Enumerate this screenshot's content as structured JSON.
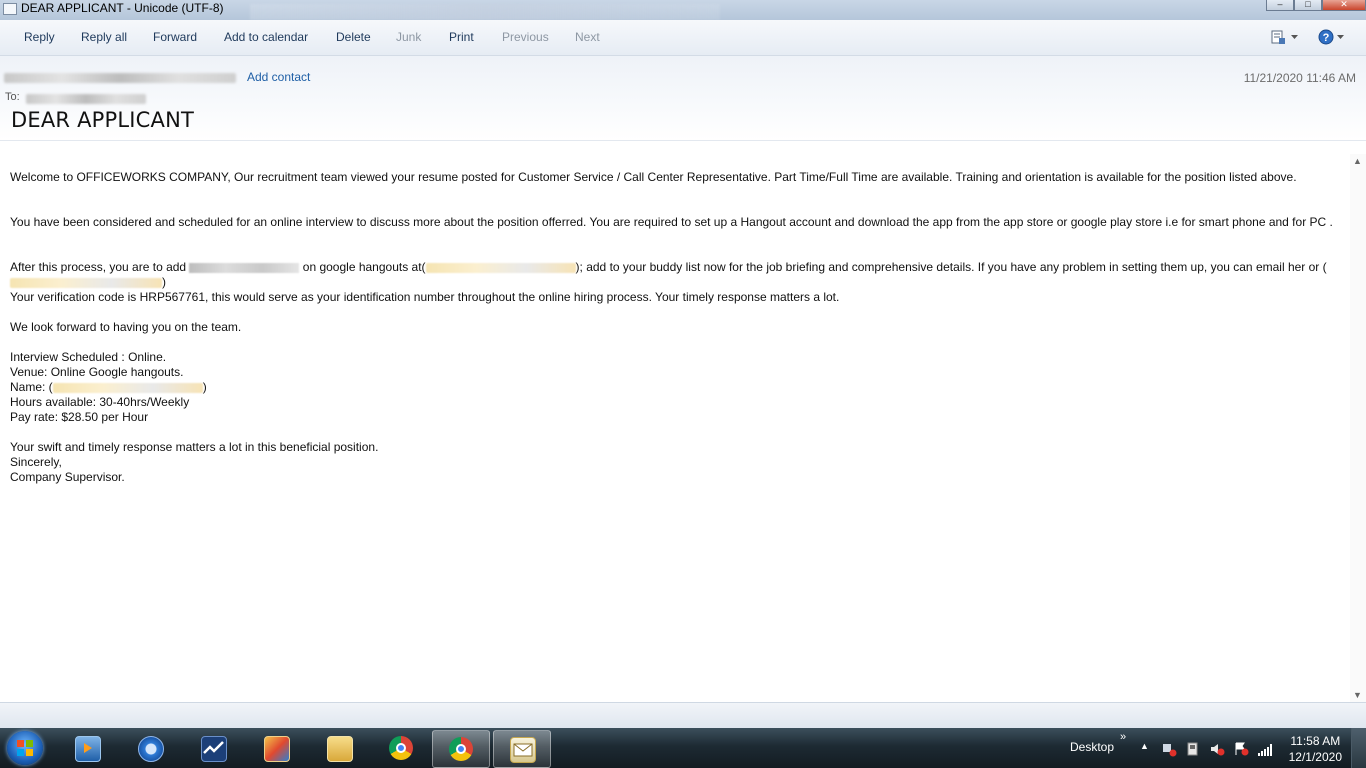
{
  "window": {
    "title": "DEAR APPLICANT - Unicode (UTF-8)",
    "minimize": "–",
    "maximize": "□",
    "close": "✕"
  },
  "toolbar": {
    "reply": "Reply",
    "reply_all": "Reply all",
    "forward": "Forward",
    "add_to_calendar": "Add to calendar",
    "delete": "Delete",
    "junk": "Junk",
    "print": "Print",
    "previous": "Previous",
    "next": "Next",
    "right_icons": [
      "encoding-icon",
      "help-icon"
    ]
  },
  "header": {
    "add_contact": "Add contact",
    "date": "11/21/2020 11:46 AM",
    "to_label": "To:",
    "subject": "DEAR APPLICANT"
  },
  "body": {
    "p1": " Welcome to  OFFICEWORKS COMPANY, Our recruitment team viewed your resume posted    for Customer Service / Call Center Representative. Part Time/Full Time  are available.  Training and orientation is available for the position listed above.",
    "p2": "You have been considered and scheduled for an online interview to discuss more about the position offerred. You are required to set up a  Hangout account and download the app  from the app store or google play store i.e for smart phone and for PC .",
    "p3_a": "After this process, you are to add ",
    "p3_b": " on  google hangouts at(",
    "p3_c": "); add to your buddy list now for the job briefing and comprehensive details. If you have any problem in setting them up, you can email her or (",
    "p3_d": ")",
    "p4": "Your verification code is HRP567761, this would serve as your identification number throughout the online hiring process. Your timely response matters a lot.",
    "p5": "We look forward to having you on the team.",
    "interview": "Interview Scheduled : Online.",
    "venue": "Venue: Online  Google hangouts.",
    "name_a": " Name: (",
    "name_b": ")",
    "hours": "Hours available:  30-40hrs/Weekly",
    "pay": "Pay rate: $28.50  per Hour",
    "p6": "Your swift and timely response matters a lot in this beneficial position.",
    "sincerely": "Sincerely,",
    "signature": "Company Supervisor."
  },
  "taskbar": {
    "desktop": "Desktop",
    "chevron": "»",
    "time": "11:58 AM",
    "date": "12/1/2020",
    "apps": [
      "media-player-icon",
      "chrome-outline-icon",
      "stocks-app-icon",
      "paint-app-icon",
      "file-explorer-icon",
      "chrome-icon",
      "chrome-active-icon",
      "windows-live-mail-icon"
    ]
  }
}
